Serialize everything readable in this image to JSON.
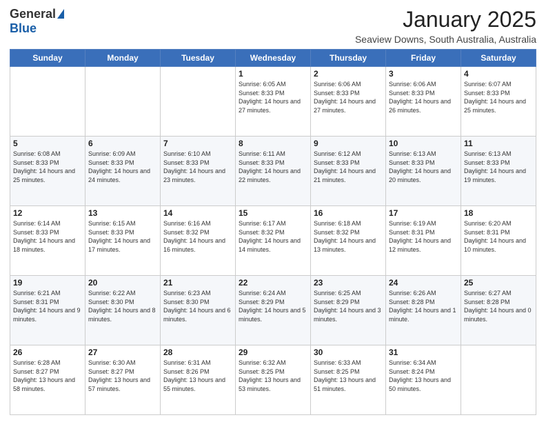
{
  "logo": {
    "general": "General",
    "blue": "Blue"
  },
  "title": "January 2025",
  "location": "Seaview Downs, South Australia, Australia",
  "days_of_week": [
    "Sunday",
    "Monday",
    "Tuesday",
    "Wednesday",
    "Thursday",
    "Friday",
    "Saturday"
  ],
  "weeks": [
    [
      {
        "day": "",
        "sunrise": "",
        "sunset": "",
        "daylight": ""
      },
      {
        "day": "",
        "sunrise": "",
        "sunset": "",
        "daylight": ""
      },
      {
        "day": "",
        "sunrise": "",
        "sunset": "",
        "daylight": ""
      },
      {
        "day": "1",
        "sunrise": "Sunrise: 6:05 AM",
        "sunset": "Sunset: 8:33 PM",
        "daylight": "Daylight: 14 hours and 27 minutes."
      },
      {
        "day": "2",
        "sunrise": "Sunrise: 6:06 AM",
        "sunset": "Sunset: 8:33 PM",
        "daylight": "Daylight: 14 hours and 27 minutes."
      },
      {
        "day": "3",
        "sunrise": "Sunrise: 6:06 AM",
        "sunset": "Sunset: 8:33 PM",
        "daylight": "Daylight: 14 hours and 26 minutes."
      },
      {
        "day": "4",
        "sunrise": "Sunrise: 6:07 AM",
        "sunset": "Sunset: 8:33 PM",
        "daylight": "Daylight: 14 hours and 25 minutes."
      }
    ],
    [
      {
        "day": "5",
        "sunrise": "Sunrise: 6:08 AM",
        "sunset": "Sunset: 8:33 PM",
        "daylight": "Daylight: 14 hours and 25 minutes."
      },
      {
        "day": "6",
        "sunrise": "Sunrise: 6:09 AM",
        "sunset": "Sunset: 8:33 PM",
        "daylight": "Daylight: 14 hours and 24 minutes."
      },
      {
        "day": "7",
        "sunrise": "Sunrise: 6:10 AM",
        "sunset": "Sunset: 8:33 PM",
        "daylight": "Daylight: 14 hours and 23 minutes."
      },
      {
        "day": "8",
        "sunrise": "Sunrise: 6:11 AM",
        "sunset": "Sunset: 8:33 PM",
        "daylight": "Daylight: 14 hours and 22 minutes."
      },
      {
        "day": "9",
        "sunrise": "Sunrise: 6:12 AM",
        "sunset": "Sunset: 8:33 PM",
        "daylight": "Daylight: 14 hours and 21 minutes."
      },
      {
        "day": "10",
        "sunrise": "Sunrise: 6:13 AM",
        "sunset": "Sunset: 8:33 PM",
        "daylight": "Daylight: 14 hours and 20 minutes."
      },
      {
        "day": "11",
        "sunrise": "Sunrise: 6:13 AM",
        "sunset": "Sunset: 8:33 PM",
        "daylight": "Daylight: 14 hours and 19 minutes."
      }
    ],
    [
      {
        "day": "12",
        "sunrise": "Sunrise: 6:14 AM",
        "sunset": "Sunset: 8:33 PM",
        "daylight": "Daylight: 14 hours and 18 minutes."
      },
      {
        "day": "13",
        "sunrise": "Sunrise: 6:15 AM",
        "sunset": "Sunset: 8:33 PM",
        "daylight": "Daylight: 14 hours and 17 minutes."
      },
      {
        "day": "14",
        "sunrise": "Sunrise: 6:16 AM",
        "sunset": "Sunset: 8:32 PM",
        "daylight": "Daylight: 14 hours and 16 minutes."
      },
      {
        "day": "15",
        "sunrise": "Sunrise: 6:17 AM",
        "sunset": "Sunset: 8:32 PM",
        "daylight": "Daylight: 14 hours and 14 minutes."
      },
      {
        "day": "16",
        "sunrise": "Sunrise: 6:18 AM",
        "sunset": "Sunset: 8:32 PM",
        "daylight": "Daylight: 14 hours and 13 minutes."
      },
      {
        "day": "17",
        "sunrise": "Sunrise: 6:19 AM",
        "sunset": "Sunset: 8:31 PM",
        "daylight": "Daylight: 14 hours and 12 minutes."
      },
      {
        "day": "18",
        "sunrise": "Sunrise: 6:20 AM",
        "sunset": "Sunset: 8:31 PM",
        "daylight": "Daylight: 14 hours and 10 minutes."
      }
    ],
    [
      {
        "day": "19",
        "sunrise": "Sunrise: 6:21 AM",
        "sunset": "Sunset: 8:31 PM",
        "daylight": "Daylight: 14 hours and 9 minutes."
      },
      {
        "day": "20",
        "sunrise": "Sunrise: 6:22 AM",
        "sunset": "Sunset: 8:30 PM",
        "daylight": "Daylight: 14 hours and 8 minutes."
      },
      {
        "day": "21",
        "sunrise": "Sunrise: 6:23 AM",
        "sunset": "Sunset: 8:30 PM",
        "daylight": "Daylight: 14 hours and 6 minutes."
      },
      {
        "day": "22",
        "sunrise": "Sunrise: 6:24 AM",
        "sunset": "Sunset: 8:29 PM",
        "daylight": "Daylight: 14 hours and 5 minutes."
      },
      {
        "day": "23",
        "sunrise": "Sunrise: 6:25 AM",
        "sunset": "Sunset: 8:29 PM",
        "daylight": "Daylight: 14 hours and 3 minutes."
      },
      {
        "day": "24",
        "sunrise": "Sunrise: 6:26 AM",
        "sunset": "Sunset: 8:28 PM",
        "daylight": "Daylight: 14 hours and 1 minute."
      },
      {
        "day": "25",
        "sunrise": "Sunrise: 6:27 AM",
        "sunset": "Sunset: 8:28 PM",
        "daylight": "Daylight: 14 hours and 0 minutes."
      }
    ],
    [
      {
        "day": "26",
        "sunrise": "Sunrise: 6:28 AM",
        "sunset": "Sunset: 8:27 PM",
        "daylight": "Daylight: 13 hours and 58 minutes."
      },
      {
        "day": "27",
        "sunrise": "Sunrise: 6:30 AM",
        "sunset": "Sunset: 8:27 PM",
        "daylight": "Daylight: 13 hours and 57 minutes."
      },
      {
        "day": "28",
        "sunrise": "Sunrise: 6:31 AM",
        "sunset": "Sunset: 8:26 PM",
        "daylight": "Daylight: 13 hours and 55 minutes."
      },
      {
        "day": "29",
        "sunrise": "Sunrise: 6:32 AM",
        "sunset": "Sunset: 8:25 PM",
        "daylight": "Daylight: 13 hours and 53 minutes."
      },
      {
        "day": "30",
        "sunrise": "Sunrise: 6:33 AM",
        "sunset": "Sunset: 8:25 PM",
        "daylight": "Daylight: 13 hours and 51 minutes."
      },
      {
        "day": "31",
        "sunrise": "Sunrise: 6:34 AM",
        "sunset": "Sunset: 8:24 PM",
        "daylight": "Daylight: 13 hours and 50 minutes."
      },
      {
        "day": "",
        "sunrise": "",
        "sunset": "",
        "daylight": ""
      }
    ]
  ]
}
